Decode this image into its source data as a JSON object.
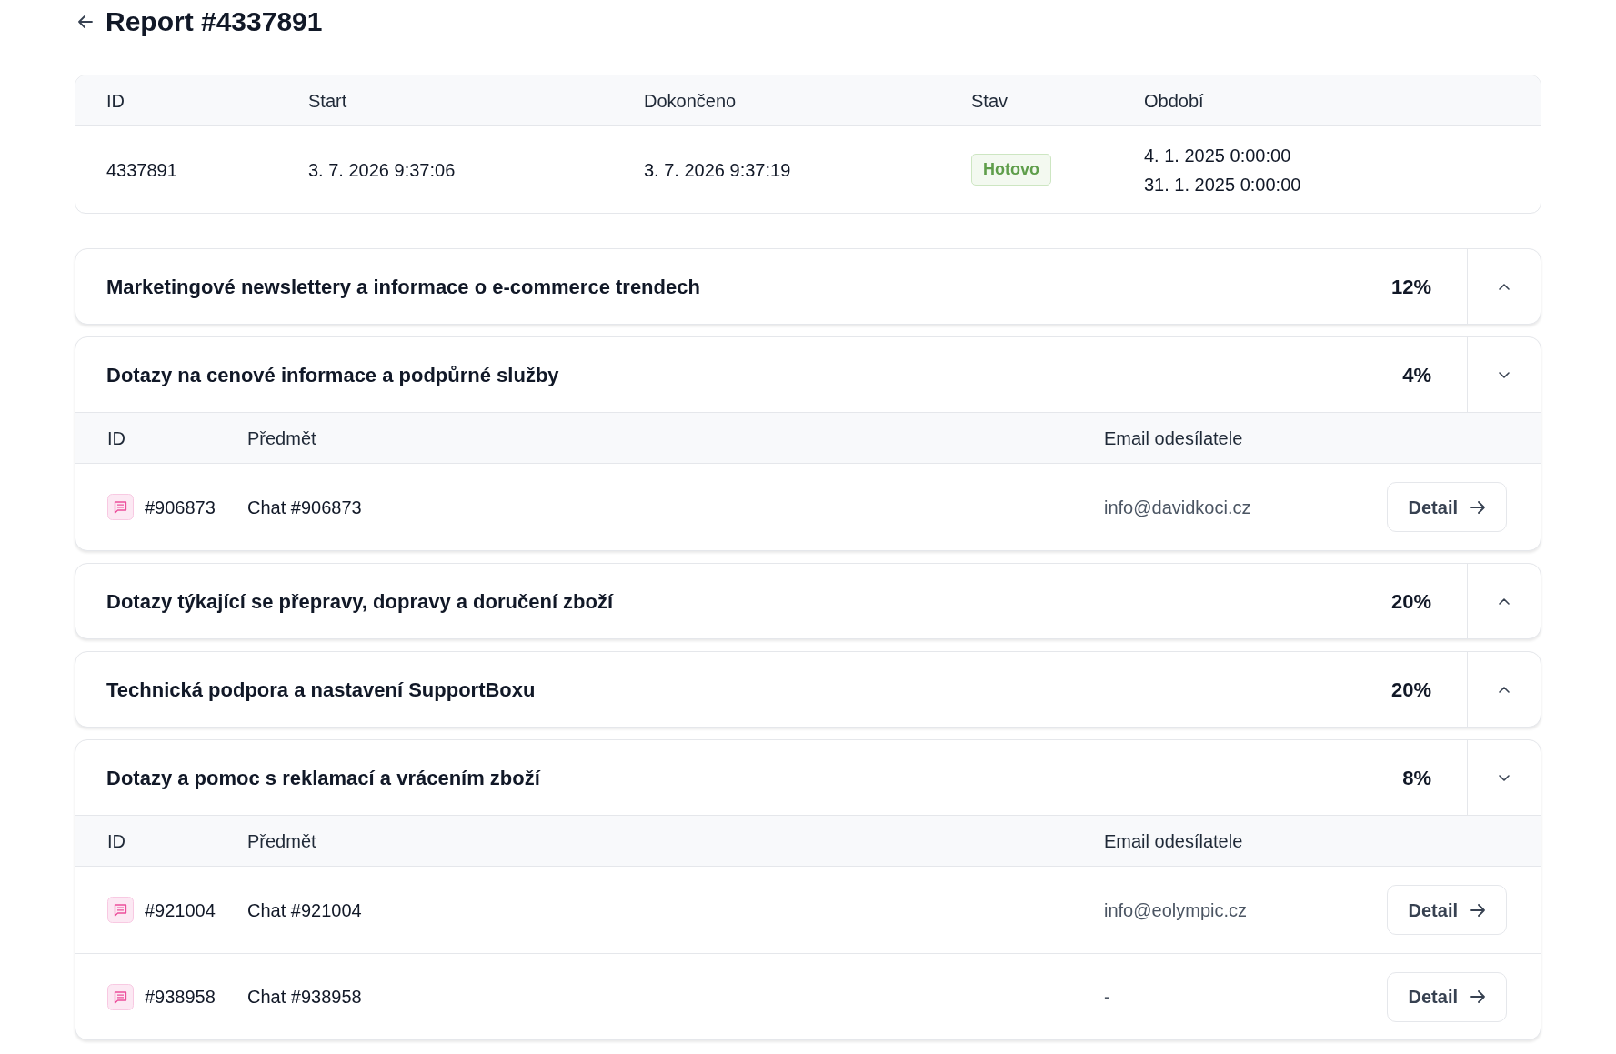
{
  "header": {
    "title": "Report #4337891"
  },
  "summary": {
    "columns": [
      "ID",
      "Start",
      "Dokončeno",
      "Stav",
      "Období"
    ],
    "row": {
      "id": "4337891",
      "start": "3. 7. 2026 9:37:06",
      "finished": "3. 7. 2026 9:37:19",
      "status": "Hotovo",
      "period": [
        "4. 1. 2025 0:00:00",
        "31. 1. 2025 0:00:00"
      ]
    }
  },
  "categories": [
    {
      "title": "Marketingové newslettery a informace o e-commerce trendech",
      "share": "12%",
      "expanded": false
    },
    {
      "title": "Dotazy na cenové informace a podpůrné služby",
      "share": "4%",
      "expanded": true,
      "table": {
        "columns": [
          "ID",
          "Předmět",
          "Email odesílatele"
        ],
        "rows": [
          {
            "id": "#906873",
            "subject": "Chat #906873",
            "email": "info@davidkoci.cz",
            "action": "Detail"
          }
        ]
      }
    },
    {
      "title": "Dotazy týkající se přepravy, dopravy a doručení zboží",
      "share": "20%",
      "expanded": false
    },
    {
      "title": "Technická podpora a nastavení SupportBoxu",
      "share": "20%",
      "expanded": false
    },
    {
      "title": "Dotazy a pomoc s reklamací a vrácením zboží",
      "share": "8%",
      "expanded": true,
      "table": {
        "columns": [
          "ID",
          "Předmět",
          "Email odesílatele"
        ],
        "rows": [
          {
            "id": "#921004",
            "subject": "Chat #921004",
            "email": "info@eolympic.cz",
            "action": "Detail"
          },
          {
            "id": "#938958",
            "subject": "Chat #938958",
            "email": "-",
            "action": "Detail"
          }
        ]
      }
    }
  ]
}
